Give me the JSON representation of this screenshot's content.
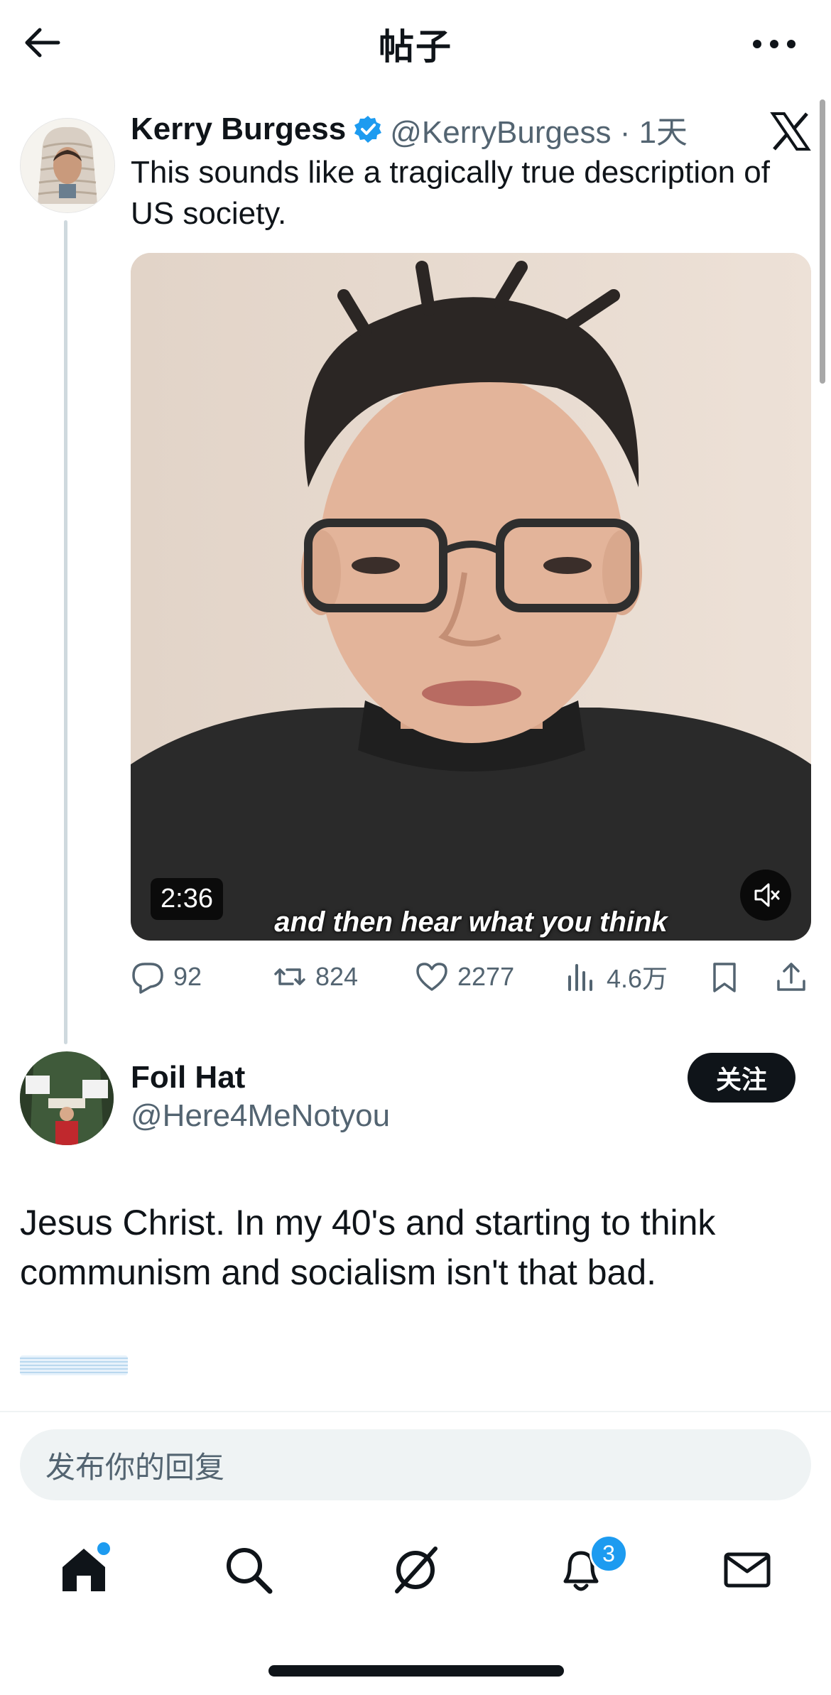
{
  "header": {
    "title": "帖子",
    "back_icon": "arrow-left-icon",
    "more_icon": "ellipsis-icon"
  },
  "tweet": {
    "author_name": "Kerry Burgess",
    "handle_time": "@KerryBurgess · 1天",
    "text": "This sounds like a tragically true description of US society.",
    "video": {
      "duration": "2:36",
      "caption": "and then hear what you think"
    },
    "stats": {
      "replies": "92",
      "reposts": "824",
      "likes": "2277",
      "views": "4.6万"
    }
  },
  "reply_tweet": {
    "author_name": "Foil Hat",
    "handle": "@Here4MeNotyou",
    "follow_label": "关注",
    "text": "Jesus Christ. In my 40's and starting to think communism and socialism isn't that bad."
  },
  "composer": {
    "placeholder": "发布你的回复"
  },
  "bottom_nav": {
    "notifications_badge": "3"
  },
  "colors": {
    "accent": "#1d9bf0",
    "text": "#0f1419",
    "muted": "#536471"
  }
}
